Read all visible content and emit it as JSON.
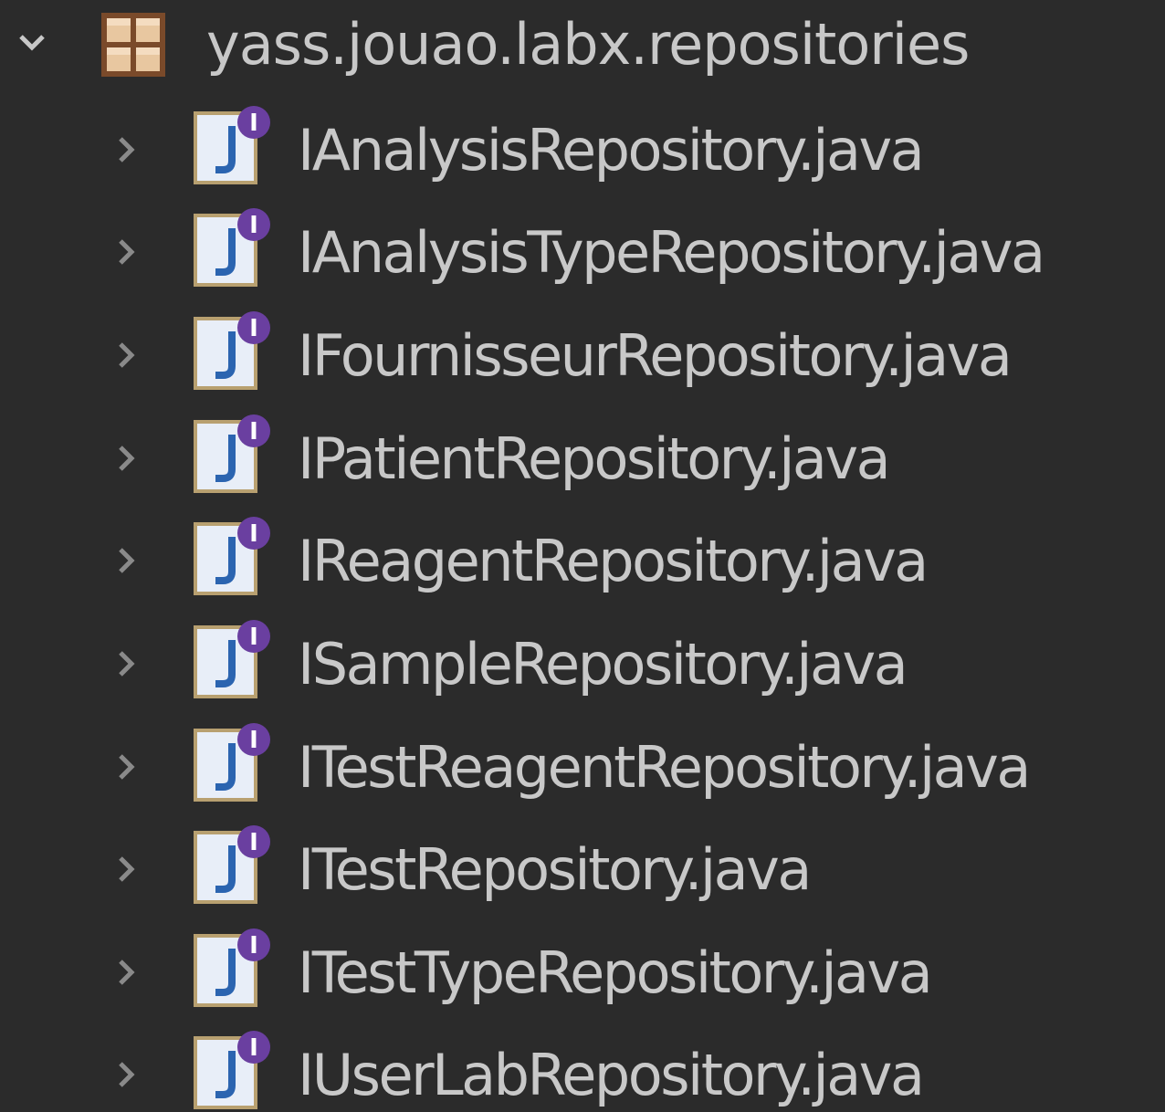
{
  "package": {
    "name": "yass.jouao.labx.repositories",
    "expanded": true,
    "icon": "package-icon"
  },
  "files": [
    {
      "label": "IAnalysisRepository.java",
      "icon": "java-interface-icon"
    },
    {
      "label": "IAnalysisTypeRepository.java",
      "icon": "java-interface-icon"
    },
    {
      "label": "IFournisseurRepository.java",
      "icon": "java-interface-icon"
    },
    {
      "label": "IPatientRepository.java",
      "icon": "java-interface-icon"
    },
    {
      "label": "IReagentRepository.java",
      "icon": "java-interface-icon"
    },
    {
      "label": "ISampleRepository.java",
      "icon": "java-interface-icon"
    },
    {
      "label": "ITestReagentRepository.java",
      "icon": "java-interface-icon"
    },
    {
      "label": "ITestRepository.java",
      "icon": "java-interface-icon"
    },
    {
      "label": "ITestTypeRepository.java",
      "icon": "java-interface-icon"
    },
    {
      "label": "IUserLabRepository.java",
      "icon": "java-interface-icon"
    }
  ],
  "colors": {
    "background": "#2b2b2b",
    "text": "#c8c8c8",
    "interface_badge": "#6a3fa0",
    "file_border": "#b8a070"
  }
}
